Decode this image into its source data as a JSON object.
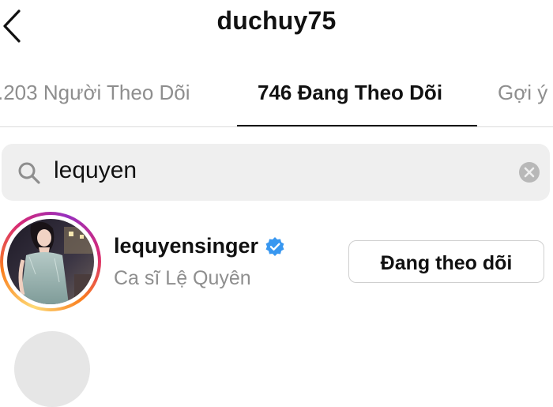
{
  "header": {
    "title": "duchuy75",
    "back_icon": "chevron-left-icon"
  },
  "tabs": [
    {
      "label": ".203 Người Theo Dõi",
      "active": false
    },
    {
      "label": "746 Đang Theo Dõi",
      "active": true
    },
    {
      "label": "Gợi ý",
      "active": false
    }
  ],
  "search": {
    "value": "lequyen",
    "icon": "search-icon",
    "clear_icon": "clear-icon"
  },
  "results": [
    {
      "username": "lequyensinger",
      "verified": true,
      "subtitle": "Ca sĩ Lệ Quyên",
      "button_label": "Đang theo dõi"
    }
  ],
  "colors": {
    "text": "#111111",
    "muted": "#8e8e8e",
    "search_bg": "#efefef",
    "verified_blue": "#3897f0",
    "divider": "#dcdcdc"
  }
}
